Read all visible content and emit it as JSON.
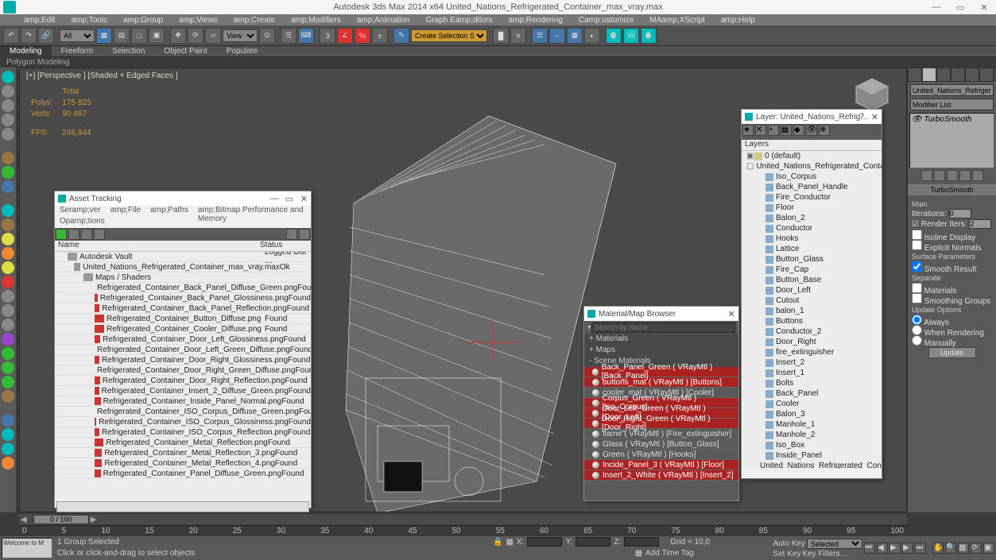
{
  "app": {
    "title": "Autodesk 3ds Max  2014 x64   United_Nations_Refrigerated_Container_max_vray.max"
  },
  "menu": [
    "amp;Edit",
    "amp;Tools",
    "amp;Group",
    "amp;Views",
    "amp;Create",
    "amp;Modifiers",
    "amp;Animation",
    "Graph Eamp;ditors",
    "amp;Rendering",
    "Camp;ustomize",
    "MAamp;XScript",
    "amp;Help"
  ],
  "toolbar": {
    "sel_filter": "All",
    "ref_coord": "View",
    "create_sel": "Create Selection S…"
  },
  "ribbon": {
    "tabs": [
      "Modeling",
      "Freeform",
      "Selection",
      "Object Paint",
      "Populate"
    ],
    "active": 0,
    "sub": "Polygon Modeling"
  },
  "viewport": {
    "label": "[+] [Perspective ] [Shaded + Edged Faces ]",
    "stats": {
      "head_total": "Total",
      "polys_l": "Polys:",
      "polys_v": "175 825",
      "verts_l": "Verts:",
      "verts_v": "90 467",
      "fps_l": "FPS:",
      "fps_v": "246,944"
    }
  },
  "asset": {
    "title": "Asset Tracking",
    "menu": [
      "Seramp;ver",
      "amp;File",
      "amp;Paths",
      "amp;Bitmap Performance and Memory"
    ],
    "menu2": "Opamp;tions",
    "col_name": "Name",
    "col_status": "Status",
    "rows": [
      {
        "n": "Autodesk Vault",
        "s": "Logged Out …",
        "t": "vault"
      },
      {
        "n": "United_Nations_Refrigerated_Container_max_vray.max",
        "s": "Ok",
        "t": "max"
      },
      {
        "n": "Maps / Shaders",
        "s": "",
        "t": "group"
      },
      {
        "n": "Refrigerated_Container_Back_Panel_Diffuse_Green.png",
        "s": "Found",
        "t": "img"
      },
      {
        "n": "Refrigerated_Container_Back_Panel_Glossiness.png",
        "s": "Found",
        "t": "img"
      },
      {
        "n": "Refrigerated_Container_Back_Panel_Reflection.png",
        "s": "Found",
        "t": "img"
      },
      {
        "n": "Refrigerated_Container_Button_Diffuse.png",
        "s": "Found",
        "t": "img"
      },
      {
        "n": "Refrigerated_Container_Cooler_Diffuse.png",
        "s": "Found",
        "t": "img"
      },
      {
        "n": "Refrigerated_Container_Door_Left_Glossiness.png",
        "s": "Found",
        "t": "img"
      },
      {
        "n": "Refrigerated_Container_Door_Left_Green_Diffuse.png",
        "s": "Found",
        "t": "img"
      },
      {
        "n": "Refrigerated_Container_Door_Right_Glossiness.png",
        "s": "Found",
        "t": "img"
      },
      {
        "n": "Refrigerated_Container_Door_Right_Green_Diffuse.png",
        "s": "Found",
        "t": "img"
      },
      {
        "n": "Refrigerated_Container_Door_Right_Reflection.png",
        "s": "Found",
        "t": "img"
      },
      {
        "n": "Refrigerated_Container_Insert_2_Diffuse_Green.png",
        "s": "Found",
        "t": "img"
      },
      {
        "n": "Refrigerated_Container_Inside_Panel_Normal.png",
        "s": "Found",
        "t": "img"
      },
      {
        "n": "Refrigerated_Container_ISO_Corpus_Diffuse_Green.png",
        "s": "Found",
        "t": "img"
      },
      {
        "n": "Refrigerated_Container_ISO_Corpus_Glossiness.png",
        "s": "Found",
        "t": "img"
      },
      {
        "n": "Refrigerated_Container_ISO_Corpus_Reflection.png",
        "s": "Found",
        "t": "img"
      },
      {
        "n": "Refrigerated_Container_Metal_Reflection.png",
        "s": "Found",
        "t": "img"
      },
      {
        "n": "Refrigerated_Container_Metal_Reflection_3.png",
        "s": "Found",
        "t": "img"
      },
      {
        "n": "Refrigerated_Container_Metal_Reflection_4.png",
        "s": "Found",
        "t": "img"
      },
      {
        "n": "Refrigerated_Container_Panel_Diffuse_Green.png",
        "s": "Found",
        "t": "img"
      }
    ]
  },
  "material": {
    "title": "Material/Map Browser",
    "search_ph": "Search by Name …",
    "sec_mat": "+ Materials",
    "sec_map": "+ Maps",
    "sec_scene": "- Scene Materials",
    "rows": [
      {
        "n": "Back_Panel_Green ( VRayMtl )  [Back_Panel]",
        "r": true
      },
      {
        "n": "buttons_mat ( VRayMtl ) [Buttons]",
        "r": true
      },
      {
        "n": "cooler_mat ( VRayMtl ) [Cooler]",
        "r": false
      },
      {
        "n": "Corpus_Green ( VRayMtl )  [Iso_Corpus]",
        "r": true
      },
      {
        "n": "Door_Left_Green ( VRayMtl )  [Door_Left]",
        "r": true
      },
      {
        "n": "Door_Right_Green ( VRayMtl ) [Door_Right]",
        "r": true
      },
      {
        "n": "flame ( VRayMtl )  [Fire_extinguisher]",
        "r": false
      },
      {
        "n": "Glass ( VRayMtl )  [Button_Glass]",
        "r": false
      },
      {
        "n": "Green ( VRayMtl )  [Hooks]",
        "r": false
      },
      {
        "n": "Incide_Panel_3 ( VRayMtl ) [Floor]",
        "r": true
      },
      {
        "n": "Insert_2_White ( VRayMtl ) [Insert_2]",
        "r": true
      }
    ]
  },
  "layer": {
    "title": "Layer: United_Nations_Refrig…",
    "head": "Layers",
    "rows": [
      {
        "n": "0 (default)",
        "l": 0,
        "t": "layer",
        "exp": "▣"
      },
      {
        "n": "United_Nations_Refrigerated_Container",
        "l": 0,
        "t": "layer",
        "exp": "▢"
      },
      {
        "n": "Iso_Corpus",
        "l": 1,
        "t": "obj"
      },
      {
        "n": "Back_Panel_Handle",
        "l": 1,
        "t": "obj"
      },
      {
        "n": "Fire_Conductor",
        "l": 1,
        "t": "obj"
      },
      {
        "n": "Floor",
        "l": 1,
        "t": "obj"
      },
      {
        "n": "Balon_2",
        "l": 1,
        "t": "obj"
      },
      {
        "n": "Conductor",
        "l": 1,
        "t": "obj"
      },
      {
        "n": "Hooks",
        "l": 1,
        "t": "obj"
      },
      {
        "n": "Lattice",
        "l": 1,
        "t": "obj"
      },
      {
        "n": "Button_Glass",
        "l": 1,
        "t": "obj"
      },
      {
        "n": "Fire_Cap",
        "l": 1,
        "t": "obj"
      },
      {
        "n": "Button_Base",
        "l": 1,
        "t": "obj"
      },
      {
        "n": "Door_Left",
        "l": 1,
        "t": "obj"
      },
      {
        "n": "Cutout",
        "l": 1,
        "t": "obj"
      },
      {
        "n": "balon_1",
        "l": 1,
        "t": "obj"
      },
      {
        "n": "Buttons",
        "l": 1,
        "t": "obj"
      },
      {
        "n": "Conductor_2",
        "l": 1,
        "t": "obj"
      },
      {
        "n": "Door_Right",
        "l": 1,
        "t": "obj"
      },
      {
        "n": "fire_extinguisher",
        "l": 1,
        "t": "obj"
      },
      {
        "n": "Insert_2",
        "l": 1,
        "t": "obj"
      },
      {
        "n": "Insert_1",
        "l": 1,
        "t": "obj"
      },
      {
        "n": "Bolts",
        "l": 1,
        "t": "obj"
      },
      {
        "n": "Back_Panel",
        "l": 1,
        "t": "obj"
      },
      {
        "n": "Cooler",
        "l": 1,
        "t": "obj"
      },
      {
        "n": "Balon_3",
        "l": 1,
        "t": "obj"
      },
      {
        "n": "Manhole_1",
        "l": 1,
        "t": "obj"
      },
      {
        "n": "Manhole_2",
        "l": 1,
        "t": "obj"
      },
      {
        "n": "Iso_Box",
        "l": 1,
        "t": "obj"
      },
      {
        "n": "Inside_Panel",
        "l": 1,
        "t": "obj"
      },
      {
        "n": "United_Nations_Refrigerated_Container",
        "l": 1,
        "t": "obj"
      }
    ]
  },
  "cmd": {
    "obj_name": "United_Nations_Refriger",
    "mod_list_label": "Modifier List",
    "stack_item": "TurboSmooth",
    "rollout_ts": "TurboSmooth",
    "main_l": "Main",
    "iter_l": "Iterations:",
    "iter_v": "0",
    "rend_l": "Render Iters:",
    "rend_v": "2",
    "isoline": "Isoline Display",
    "expl": "Explicit Normals",
    "surf_l": "Surface Parameters",
    "smooth": "Smooth Result",
    "sep_l": "Separate",
    "sep_mat": "Materials",
    "sep_sg": "Smoothing Groups",
    "upd_l": "Update Options",
    "upd_always": "Always",
    "upd_render": "When Rendering",
    "upd_manual": "Manually",
    "upd_btn": "Update"
  },
  "time": {
    "slider": "0 / 100",
    "ticks": [
      "0",
      "5",
      "10",
      "15",
      "20",
      "25",
      "30",
      "35",
      "40",
      "45",
      "50",
      "55",
      "60",
      "65",
      "70",
      "75",
      "80",
      "85",
      "90",
      "95",
      "100"
    ]
  },
  "status": {
    "sel": "1 Group Selected",
    "prompt": "Click or click-and-drag to select objects",
    "listener": "Welcome to M",
    "x_l": "X:",
    "y_l": "Y:",
    "z_l": "Z:",
    "grid": "Grid = 10,0",
    "autokey": "Auto Key",
    "setkey": "Set Key",
    "sel_mode": "Selected",
    "keyfilt": "Key Filters…",
    "addtimetag": "Add Time Tag"
  }
}
